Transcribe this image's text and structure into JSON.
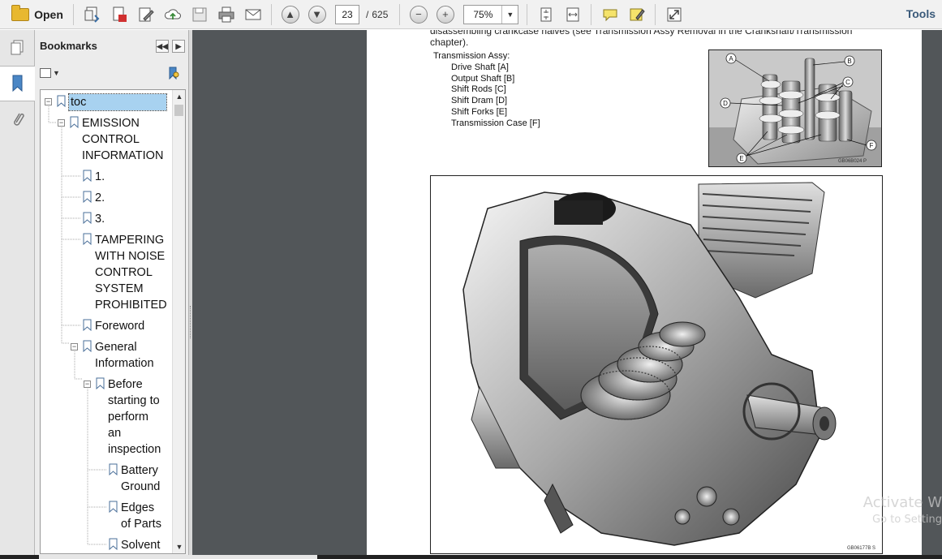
{
  "toolbar": {
    "open_label": "Open",
    "current_page": "23",
    "page_separator": "/",
    "total_pages": "625",
    "zoom": "75%",
    "tools_label": "Tools"
  },
  "bookmarks_panel": {
    "title": "Bookmarks",
    "items": [
      {
        "label": "toc"
      },
      {
        "label": "EMISSION\nCONTROL\nINFORMATION"
      },
      {
        "label": "1."
      },
      {
        "label": "2."
      },
      {
        "label": "3."
      },
      {
        "label": "TAMPERING\nWITH NOISE\nCONTROL\nSYSTEM\nPROHIBITED"
      },
      {
        "label": "Foreword"
      },
      {
        "label": "General\nInformation"
      },
      {
        "label": "Before\nstarting to\nperform\nan\ninspection"
      },
      {
        "label": "Battery\nGround"
      },
      {
        "label": "Edges\nof Parts"
      },
      {
        "label": "Solvent"
      }
    ]
  },
  "document": {
    "clipped_top_text": "disassembling crankcase halves (see Transmission Assy Removal in the Crankshaft/Transmission chapter).",
    "list_heading": "Transmission Assy:",
    "list_items": [
      "Drive Shaft [A]",
      "Output Shaft [B]",
      "Shift Rods [C]",
      "Shift Dram [D]",
      "Shift Forks [E]",
      "Transmission Case [F]"
    ],
    "small_figure_code": "GB06B024  P",
    "small_figure_labels": [
      "A",
      "B",
      "C",
      "D",
      "E",
      "F"
    ],
    "big_figure_code": "GB06177B  S"
  },
  "watermark": {
    "line1": "Activate W",
    "line2": "Go to Setting"
  }
}
